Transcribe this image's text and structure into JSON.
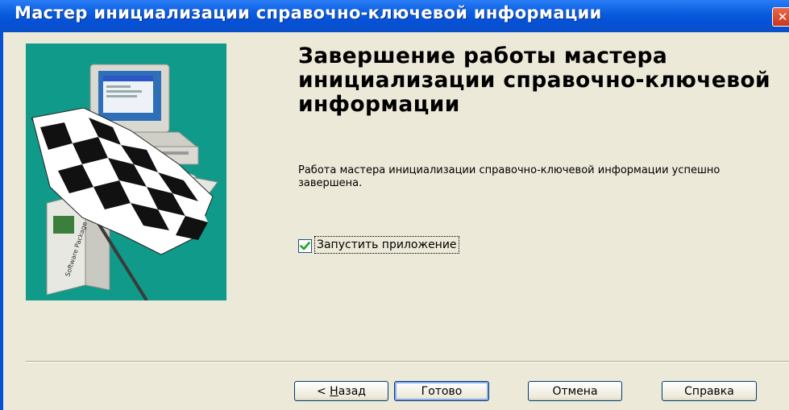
{
  "window": {
    "title": "Мастер инициализации справочно-ключевой информации",
    "close_glyph": "✕"
  },
  "heading": "Завершение работы мастера инициализации справочно-ключевой информации",
  "description": "Работа мастера инициализации справочно-ключевой информации успешно завершена.",
  "checkbox": {
    "label": "Запустить приложение",
    "checked": true
  },
  "buttons": {
    "back_prefix": "< ",
    "back_accel": "Н",
    "back_rest": "азад",
    "finish": "Готово",
    "cancel": "Отмена",
    "help": "Справка"
  },
  "colors": {
    "title_bar": "#0550d6",
    "art_background": "#0f9a89",
    "dialog_background": "#ece9d8",
    "check_mark": "#21a121"
  },
  "art_box_label": "Software Package"
}
